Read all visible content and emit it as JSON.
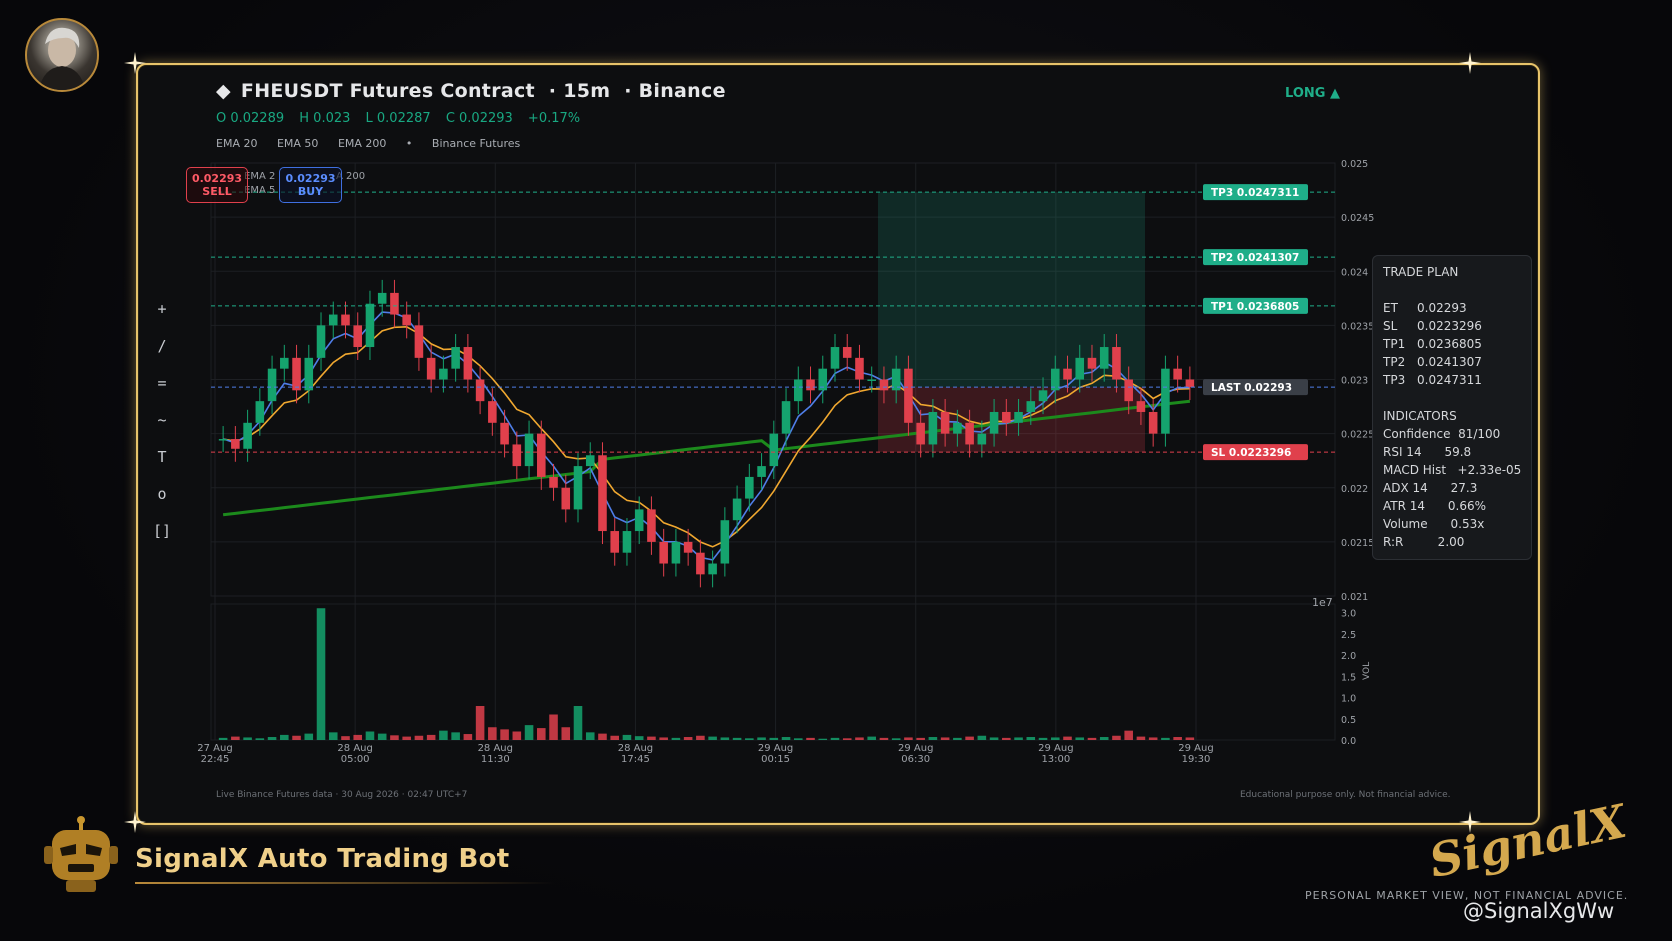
{
  "header": {
    "symbol_title": "FHEUSDT Futures Contract",
    "interval": "15m",
    "exchange": "Binance",
    "direction": "LONG ▲",
    "ohlc": {
      "open": "O 0.02289",
      "high": "H 0.023",
      "low": "L 0.02287",
      "close": "C 0.02293",
      "change": "+0.17%"
    },
    "legend": [
      "EMA 20",
      "EMA 50",
      "EMA 200",
      "•",
      "Binance Futures"
    ]
  },
  "badges": {
    "sell_price": "0.02293",
    "sell_label": "SELL",
    "buy_price": "0.02293",
    "buy_label": "BUY"
  },
  "ema_overlap": [
    "EMA 2",
    "EMA 5",
    "A 200"
  ],
  "toolbar": [
    "+",
    "/",
    "=",
    "~",
    "T",
    "o",
    "[]"
  ],
  "levels": {
    "tp3": "TP3  0.0247311",
    "tp2": "TP2  0.0241307",
    "tp1": "TP1  0.0236805",
    "last": "LAST  0.02293",
    "sl": "SL  0.0223296"
  },
  "colors": {
    "up": "#15a36e",
    "down": "#e0404c",
    "ema20": "#4f7ee8",
    "ema50": "#f0a830",
    "ema200": "#1c8a1c",
    "tp": "#1fae89",
    "sl": "#e0404c",
    "frame": "#e7c36a"
  },
  "trade_plan": {
    "title": "TRADE PLAN",
    "rows": [
      [
        "ET",
        "0.02293"
      ],
      [
        "SL",
        "0.0223296"
      ],
      [
        "TP1",
        "0.0236805"
      ],
      [
        "TP2",
        "0.0241307"
      ],
      [
        "TP3",
        "0.0247311"
      ]
    ],
    "indicators_title": "INDICATORS",
    "indicators": [
      "Confidence  81/100",
      "RSI 14      59.8",
      "MACD Hist   +2.33e-05",
      "ADX 14      27.3",
      "ATR 14      0.66%",
      "Volume      0.53x",
      "R:R         2.00"
    ]
  },
  "chart_data": {
    "type": "candlestick",
    "y_ticks": [
      "0.025",
      "0.0245",
      "0.024",
      "0.0235",
      "0.023",
      "0.0225",
      "0.022",
      "0.0215",
      "0.021"
    ],
    "y_exponent_label": "1e7",
    "ylim": [
      0.021,
      0.025
    ],
    "x_ticks": [
      [
        "27 Aug",
        "22:45"
      ],
      [
        "28 Aug",
        "05:00"
      ],
      [
        "28 Aug",
        "11:30"
      ],
      [
        "28 Aug",
        "17:45"
      ],
      [
        "29 Aug",
        "00:15"
      ],
      [
        "29 Aug",
        "06:30"
      ],
      [
        "29 Aug",
        "13:00"
      ],
      [
        "29 Aug",
        "19:30"
      ]
    ],
    "volume_ticks": [
      "3.0",
      "2.5",
      "2.0",
      "1.5",
      "1.0",
      "0.5",
      "0.0"
    ],
    "volume_axis_label": "VOL",
    "volume_ylim": [
      0,
      3.2
    ],
    "entry": 0.02293,
    "stop_loss": 0.0223296,
    "take_profits": [
      0.0236805,
      0.0241307,
      0.0247311
    ],
    "close_path": [
      0.02245,
      0.02236,
      0.0226,
      0.0228,
      0.0231,
      0.0232,
      0.0229,
      0.0232,
      0.0235,
      0.0236,
      0.0235,
      0.0233,
      0.0237,
      0.0238,
      0.0236,
      0.0235,
      0.0232,
      0.023,
      0.0231,
      0.0233,
      0.023,
      0.0228,
      0.0226,
      0.0224,
      0.0222,
      0.0225,
      0.0221,
      0.022,
      0.0218,
      0.0222,
      0.0223,
      0.0216,
      0.0214,
      0.0216,
      0.0218,
      0.0215,
      0.0213,
      0.0215,
      0.0214,
      0.0212,
      0.0213,
      0.0217,
      0.0219,
      0.0221,
      0.0222,
      0.0225,
      0.0228,
      0.023,
      0.0229,
      0.0231,
      0.0233,
      0.0232,
      0.023,
      0.023,
      0.0229,
      0.0231,
      0.0226,
      0.0224,
      0.0227,
      0.0225,
      0.0226,
      0.0224,
      0.0225,
      0.0227,
      0.0226,
      0.0227,
      0.0228,
      0.0229,
      0.0231,
      0.023,
      0.0232,
      0.0231,
      0.0233,
      0.023,
      0.0228,
      0.0227,
      0.0225,
      0.0231,
      0.023,
      0.02293
    ],
    "volume_path": [
      0.05,
      0.08,
      0.06,
      0.04,
      0.07,
      0.12,
      0.1,
      0.15,
      3.1,
      0.18,
      0.09,
      0.12,
      0.2,
      0.15,
      0.11,
      0.08,
      0.1,
      0.12,
      0.22,
      0.18,
      0.14,
      0.8,
      0.3,
      0.25,
      0.2,
      0.35,
      0.28,
      0.6,
      0.3,
      0.8,
      0.18,
      0.15,
      0.1,
      0.12,
      0.09,
      0.08,
      0.06,
      0.05,
      0.07,
      0.1,
      0.08,
      0.06,
      0.05,
      0.04,
      0.06,
      0.05,
      0.07,
      0.04,
      0.05,
      0.03,
      0.05,
      0.04,
      0.06,
      0.08,
      0.05,
      0.04,
      0.06,
      0.05,
      0.07,
      0.06,
      0.05,
      0.08,
      0.1,
      0.06,
      0.05,
      0.06,
      0.07,
      0.05,
      0.06,
      0.08,
      0.06,
      0.05,
      0.07,
      0.1,
      0.22,
      0.08,
      0.06,
      0.05,
      0.07,
      0.06
    ]
  },
  "footer": {
    "left": "Live Binance Futures data  ·  30 Aug 2026 · 02:47 UTC+7",
    "right": "Educational purpose only. Not financial advice."
  },
  "branding": {
    "bot_name": "SignalX Auto Trading Bot",
    "logo": "SignalX",
    "disclaimer": "PERSONAL MARKET VIEW, NOT FINANCIAL ADVICE.",
    "watermark": "@SignalXgWw"
  }
}
